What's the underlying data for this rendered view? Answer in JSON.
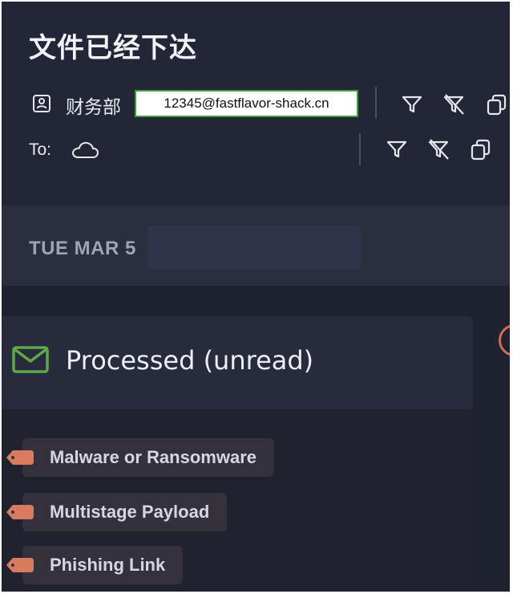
{
  "email": {
    "subject": "文件已经下达",
    "from": {
      "name": "财务部",
      "address": "12345@fastflavor-shack.cn"
    },
    "to": {
      "label": "To:"
    },
    "date": "TUE MAR 5",
    "status": "Processed (unread)",
    "tags": [
      {
        "label": "Malware or Ransomware"
      },
      {
        "label": "Multistage Payload"
      },
      {
        "label": "Phishing Link"
      }
    ]
  },
  "icons": {
    "contact": "contact-card-icon",
    "to_recipient": "cloud-icon",
    "filter": "filter-icon",
    "clear_filter": "filter-clear-icon",
    "copy": "copy-icon",
    "status": "mail-icon",
    "tag": "tag-icon"
  },
  "colors": {
    "background": "#1e2130",
    "header": "#232637",
    "email_highlight_border": "#3f9d3a",
    "mail_icon": "#5fa84a",
    "tag_accent": "#d97b5f"
  }
}
